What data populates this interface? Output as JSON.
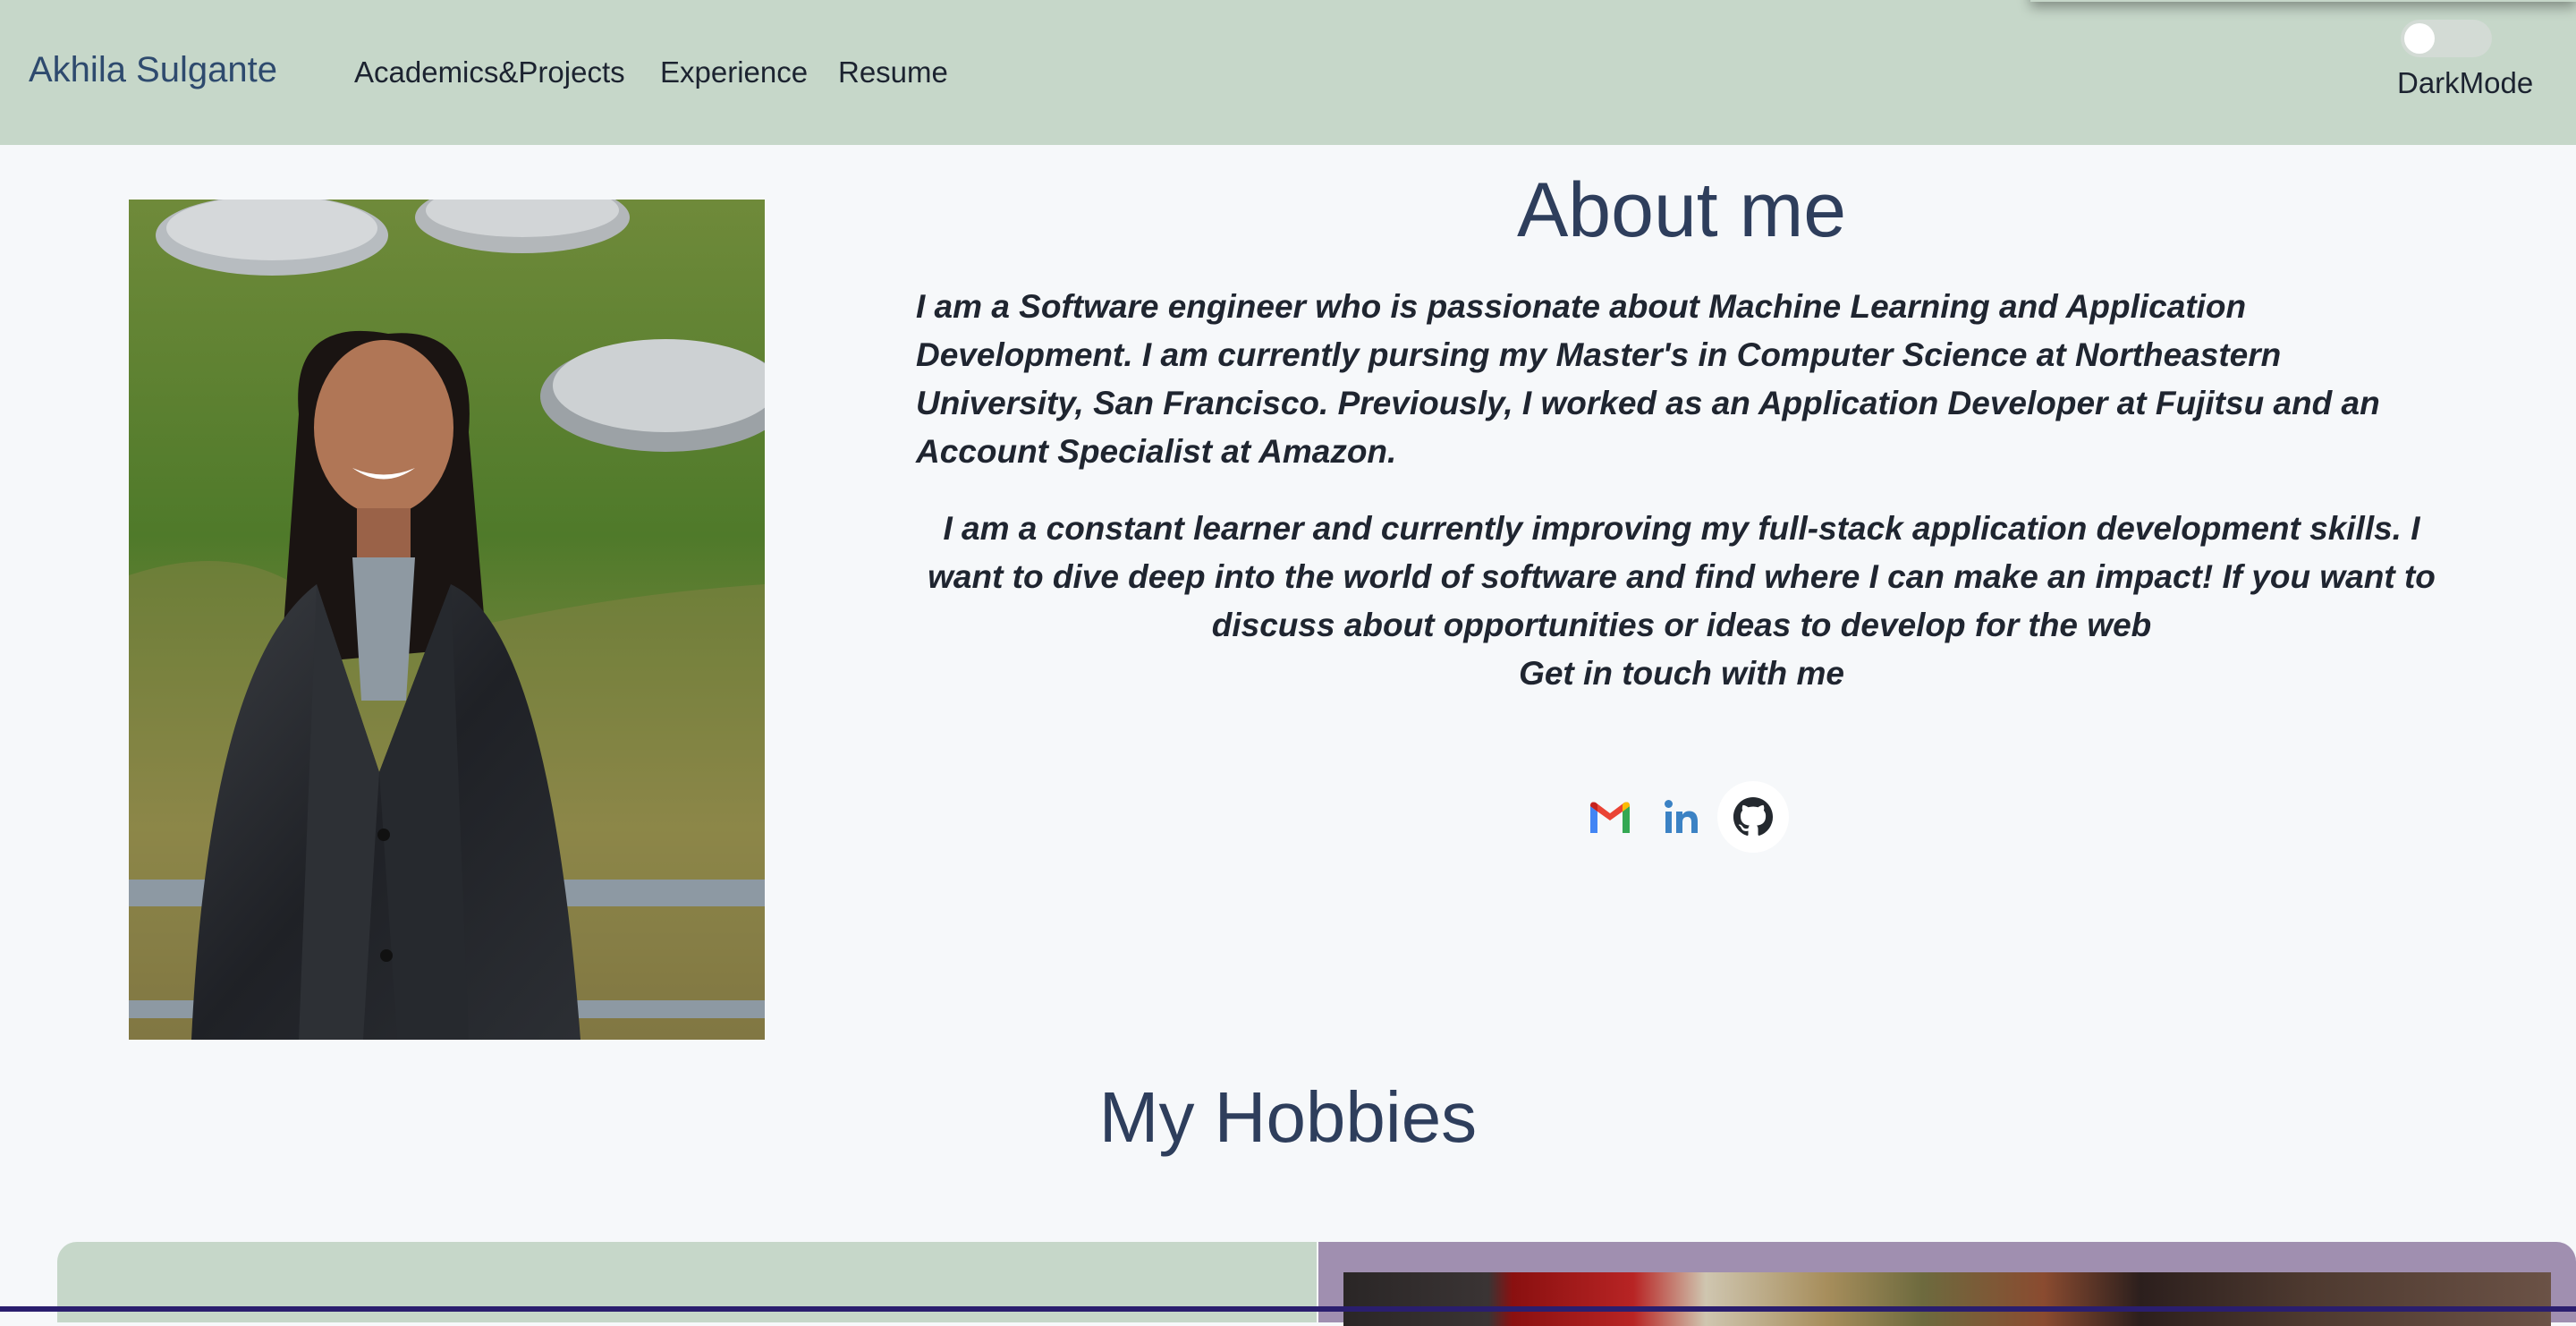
{
  "nav": {
    "brand": "Akhila Sulgante",
    "links": [
      "Academics&Projects",
      "Experience",
      "Resume"
    ],
    "dark_mode_label": "DarkMode",
    "dark_mode_on": false
  },
  "about": {
    "title": "About me",
    "paragraph1": "I am a Software engineer who is passionate about Machine Learning and Application Development. I am currently pursing my Master's in Computer Science at Northeastern University, San Francisco. Previously, I worked as an Application Developer at Fujitsu and an Account Specialist at Amazon.",
    "paragraph2": "I am a constant learner and currently improving my full-stack application development skills. I want to dive deep into the world of software and find where I can make an impact! If you want to discuss about opportunities or ideas to develop for the web",
    "cta": "Get in touch with me",
    "social_icons": [
      "gmail-icon",
      "linkedin-icon",
      "github-icon"
    ]
  },
  "hobbies": {
    "title": "My Hobbies"
  },
  "colors": {
    "navbar": "#c6d7c9",
    "heading": "#2e3e5c",
    "page_bg": "#f6f8fa",
    "hobby_card_right": "#a08fb0"
  }
}
